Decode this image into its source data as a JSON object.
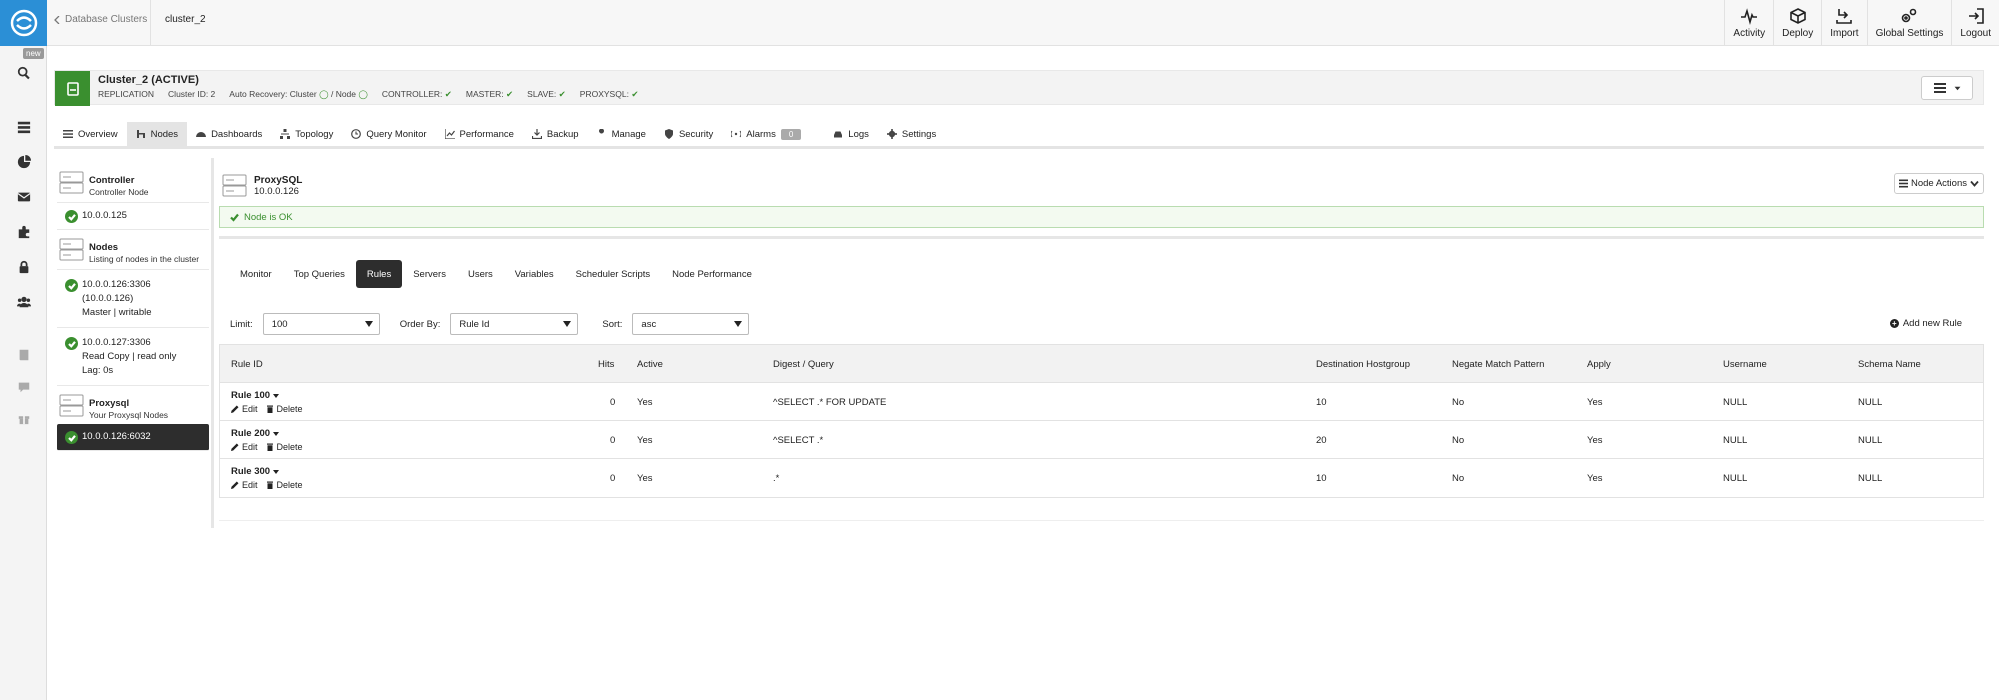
{
  "breadcrumb": {
    "back_label": "Database Clusters",
    "current": "cluster_2"
  },
  "rail": {
    "new_badge": "new",
    "icons": [
      "search-icon",
      "stack-icon",
      "pie-chart-icon",
      "mail-icon",
      "puzzle-icon",
      "lock-icon",
      "users-icon",
      "book-icon",
      "chat-icon",
      "gift-icon"
    ]
  },
  "topbar": {
    "buttons": [
      {
        "label": "Activity",
        "icon": "activity-icon"
      },
      {
        "label": "Deploy",
        "icon": "cube-icon"
      },
      {
        "label": "Import",
        "icon": "import-icon"
      },
      {
        "label": "Global Settings",
        "icon": "gears-icon"
      },
      {
        "label": "Logout",
        "icon": "logout-icon"
      }
    ]
  },
  "cluster": {
    "title": "Cluster_2 (ACTIVE)",
    "type": "REPLICATION",
    "cluster_id": "Cluster ID: 2",
    "auto_recovery": "Auto Recovery: Cluster",
    "auto_recovery_sep": "/ Node",
    "controller": "CONTROLLER:",
    "master": "MASTER:",
    "slave": "SLAVE:",
    "proxysql": "PROXYSQL:"
  },
  "tabs": [
    {
      "label": "Overview",
      "icon": "list-icon"
    },
    {
      "label": "Nodes",
      "icon": "nodes-icon",
      "active": true
    },
    {
      "label": "Dashboards",
      "icon": "dashboard-icon"
    },
    {
      "label": "Topology",
      "icon": "topology-icon"
    },
    {
      "label": "Query Monitor",
      "icon": "clock-icon"
    },
    {
      "label": "Performance",
      "icon": "chart-icon"
    },
    {
      "label": "Backup",
      "icon": "download-icon"
    },
    {
      "label": "Manage",
      "icon": "wrench-icon"
    },
    {
      "label": "Security",
      "icon": "shield-icon"
    },
    {
      "label": "Alarms",
      "icon": "alarm-icon",
      "badge": "0"
    },
    {
      "label": "Logs",
      "icon": "car-icon"
    },
    {
      "label": "Settings",
      "icon": "gear-icon"
    }
  ],
  "nodes": {
    "controller": {
      "title": "Controller",
      "subtitle": "Controller Node"
    },
    "controller_ip": "10.0.0.125",
    "nodes_hdr": {
      "title": "Nodes",
      "subtitle": "Listing of nodes in the cluster"
    },
    "db1": {
      "line1": "10.0.0.126:3306",
      "line2": "(10.0.0.126)",
      "line3": "Master | writable"
    },
    "db2": {
      "line1": "10.0.0.127:3306",
      "line2": "Read Copy | read only",
      "line3": "Lag: 0s"
    },
    "proxy_hdr": {
      "title": "Proxysql",
      "subtitle": "Your Proxysql Nodes"
    },
    "proxy_selected": "10.0.0.126:6032"
  },
  "detail": {
    "title": "ProxySQL",
    "ip": "10.0.0.126",
    "node_actions": "Node Actions",
    "status": "Node is OK"
  },
  "subtabs": [
    {
      "label": "Monitor"
    },
    {
      "label": "Top Queries"
    },
    {
      "label": "Rules",
      "active": true
    },
    {
      "label": "Servers"
    },
    {
      "label": "Users"
    },
    {
      "label": "Variables"
    },
    {
      "label": "Scheduler Scripts"
    },
    {
      "label": "Node Performance"
    }
  ],
  "filters": {
    "limit_label": "Limit:",
    "limit_value": "100",
    "order_label": "Order By:",
    "order_value": "Rule Id",
    "sort_label": "Sort:",
    "sort_value": "asc",
    "add_rule": "Add new Rule"
  },
  "table": {
    "headers": [
      "Rule ID",
      "Hits",
      "Active",
      "Digest / Query",
      "Destination Hostgroup",
      "Negate Match Pattern",
      "Apply",
      "Username",
      "Schema Name"
    ],
    "edit_label": "Edit",
    "delete_label": "Delete",
    "rows": [
      {
        "rule": "Rule 100",
        "hits": "0",
        "active": "Yes",
        "query": "^SELECT .* FOR UPDATE",
        "hostgroup": "10",
        "negate": "No",
        "apply": "Yes",
        "username": "NULL",
        "schema": "NULL"
      },
      {
        "rule": "Rule 200",
        "hits": "0",
        "active": "Yes",
        "query": "^SELECT .*",
        "hostgroup": "20",
        "negate": "No",
        "apply": "Yes",
        "username": "NULL",
        "schema": "NULL"
      },
      {
        "rule": "Rule 300",
        "hits": "0",
        "active": "Yes",
        "query": ".*",
        "hostgroup": "10",
        "negate": "No",
        "apply": "Yes",
        "username": "NULL",
        "schema": "NULL"
      }
    ]
  }
}
